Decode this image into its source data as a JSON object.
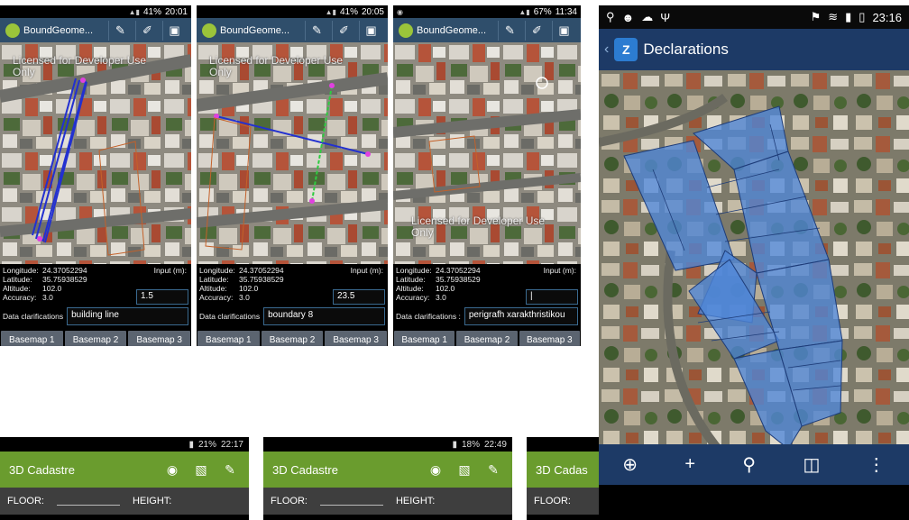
{
  "panels": [
    {
      "time": "20:01",
      "battery": "41%",
      "app_title": "BoundGeome...",
      "watermark": "Licensed for Developer Use Only",
      "longitude_label": "Longitude:",
      "longitude": "24.37052294",
      "latitude_label": "Latitude:",
      "latitude": "35.75938529",
      "altitude_label": "Altitude:",
      "altitude": "102.0",
      "accuracy_label": "Accuracy:",
      "accuracy": "3.0",
      "input_label": "Input (m):",
      "input_value": "1.5",
      "clarifications_label": "Data clarifications",
      "clarifications_value": "building line"
    },
    {
      "time": "20:05",
      "battery": "41%",
      "app_title": "BoundGeome...",
      "watermark": "Licensed for Developer Use Only",
      "longitude_label": "Longitude:",
      "longitude": "24.37052294",
      "latitude_label": "Latitude:",
      "latitude": "35.75938529",
      "altitude_label": "Altitude:",
      "altitude": "102.0",
      "accuracy_label": "Accuracy:",
      "accuracy": "3.0",
      "input_label": "Input (m):",
      "input_value": "23.5",
      "clarifications_label": "Data clarifications",
      "clarifications_value": "boundary 8"
    },
    {
      "time": "11:34",
      "battery": "67%",
      "app_title": "BoundGeome...",
      "watermark": "Licensed for Developer Use Only",
      "longitude_label": "Longitude:",
      "longitude": "24.37052294",
      "latitude_label": "Latitude:",
      "latitude": "35.75938529",
      "altitude_label": "Altitude:",
      "altitude": "102.0",
      "accuracy_label": "Accuracy:",
      "accuracy": "3.0",
      "input_label": "Input (m):",
      "input_value": "|",
      "clarifications_label": "Data clarifications :",
      "clarifications_value": "perigrafh xarakthristikou"
    }
  ],
  "basemaps": [
    "Basemap 1",
    "Basemap 2",
    "Basemap 3"
  ],
  "declarations": {
    "time": "23:16",
    "title": "Declarations",
    "app_icon_letter": "Z"
  },
  "cadastre": [
    {
      "time": "22:17",
      "battery": "21%",
      "title": "3D Cadastre",
      "floor_label": "FLOOR:",
      "height_label": "HEIGHT:"
    },
    {
      "time": "22:49",
      "battery": "18%",
      "title": "3D Cadastre",
      "floor_label": "FLOOR:",
      "height_label": "HEIGHT:"
    },
    {
      "title": "3D Cadas",
      "floor_label": "FLOOR:"
    }
  ],
  "colors": {
    "toolbar_blue": "#2f4e6b",
    "cadastre_green": "#6a9c2e",
    "declarations_blue": "#1d3a66",
    "parcel_fill": "#4f86d8"
  }
}
